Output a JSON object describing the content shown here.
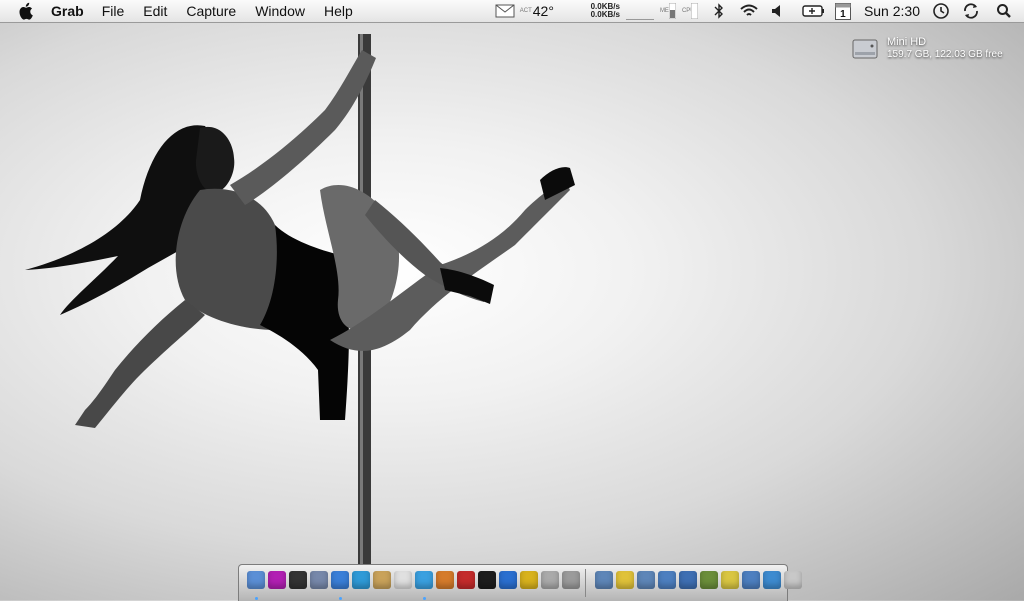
{
  "menubar": {
    "app": "Grab",
    "items": [
      "File",
      "Edit",
      "Capture",
      "Window",
      "Help"
    ],
    "status": {
      "disk_label": "ACT",
      "temp": "42°",
      "net_up": "0.0KB/s",
      "net_down": "0.0KB/s",
      "mem_label": "MEM",
      "cpu_label": "CPU",
      "calendar_day": "1",
      "clock": "Sun 2:30"
    }
  },
  "desktop": {
    "drive_name": "Mini HD",
    "drive_info": "159.7 GB, 122.03 GB free"
  },
  "dock": {
    "apps": [
      {
        "name": "finder-icon",
        "color": "#5b8fd6"
      },
      {
        "name": "app-icon",
        "color": "#b21fb3"
      },
      {
        "name": "dashboard-icon",
        "color": "#333333"
      },
      {
        "name": "mail-icon",
        "color": "#7788aa"
      },
      {
        "name": "safari-icon",
        "color": "#3a7fd8"
      },
      {
        "name": "ichat-icon",
        "color": "#2f9ad7"
      },
      {
        "name": "address-book-icon",
        "color": "#c9a25a"
      },
      {
        "name": "ical-icon",
        "color": "#e0e0e0"
      },
      {
        "name": "itunes-icon",
        "color": "#3aa0e0"
      },
      {
        "name": "iphoto-icon",
        "color": "#d57b2b"
      },
      {
        "name": "photo-booth-icon",
        "color": "#c42b2b"
      },
      {
        "name": "aperture-icon",
        "color": "#1d1d1d"
      },
      {
        "name": "photoshop-icon",
        "color": "#2a6fd0"
      },
      {
        "name": "magnet-icon",
        "color": "#d8b21c"
      },
      {
        "name": "preview-icon",
        "color": "#aaaaaa"
      },
      {
        "name": "stickies-icon",
        "color": "#9b9b9b"
      }
    ],
    "stacks": [
      {
        "name": "folder-icon",
        "color": "#5e86b8"
      },
      {
        "name": "folder-icon",
        "color": "#e0c23a"
      },
      {
        "name": "folder-icon",
        "color": "#5e86b8"
      },
      {
        "name": "folder-icon",
        "color": "#4d7fc0"
      },
      {
        "name": "folder-icon",
        "color": "#3e6fb3"
      },
      {
        "name": "folder-icon",
        "color": "#6b8e3a"
      },
      {
        "name": "folder-icon",
        "color": "#d9c642"
      },
      {
        "name": "folder-icon",
        "color": "#4d7fc0"
      },
      {
        "name": "downloads-icon",
        "color": "#3d8bd0"
      },
      {
        "name": "trash-icon",
        "color": "#c8c8c8"
      }
    ]
  }
}
